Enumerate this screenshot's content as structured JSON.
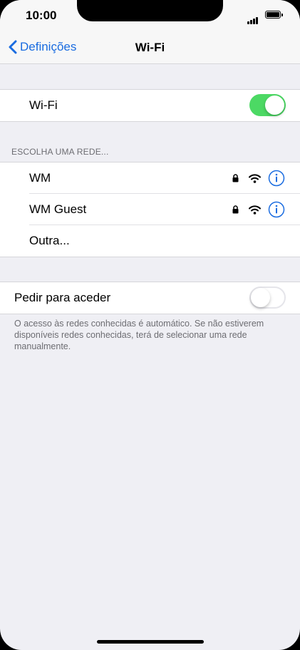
{
  "status_bar": {
    "time": "10:00"
  },
  "nav": {
    "back_label": "Definições",
    "title": "Wi-Fi"
  },
  "wifi_row": {
    "label": "Wi-Fi",
    "enabled": true
  },
  "networks": {
    "header": "ESCOLHA UMA REDE...",
    "items": [
      {
        "name": "WM",
        "secured": true,
        "icons": [
          "lock-icon",
          "wifi-signal-icon",
          "info-icon"
        ]
      },
      {
        "name": "WM Guest",
        "secured": true,
        "icons": [
          "lock-icon",
          "wifi-signal-icon",
          "info-icon"
        ]
      }
    ],
    "other_label": "Outra..."
  },
  "ask_join": {
    "label": "Pedir para aceder",
    "enabled": false,
    "footer": "O acesso às redes conhecidas é automático. Se não estiverem disponíveis redes conhecidas, terá de selecionar uma rede manualmente."
  },
  "colors": {
    "accent": "#1a6ce0",
    "toggle_on": "#4cd964",
    "background": "#efeff4"
  }
}
